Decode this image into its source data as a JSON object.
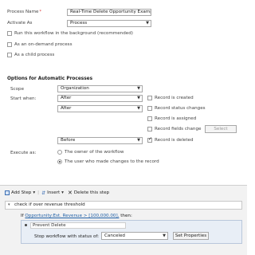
{
  "process": {
    "name_label": "Process Name",
    "required_marker": "*",
    "name_value": "Real-Time Delete Opportunity Example",
    "activate_as_label": "Activate As",
    "activate_as_value": "Process"
  },
  "options": {
    "run_background": "Run this workflow in the background (recommended)",
    "on_demand": "As an on-demand process",
    "child_process": "As a child process"
  },
  "automatic": {
    "title": "Options for Automatic Processes",
    "scope_label": "Scope",
    "scope_value": "Organization",
    "start_when_label": "Start when:",
    "after_1": "After",
    "after_2": "After",
    "before": "Before",
    "record_created": "Record is created",
    "record_status": "Record status changes",
    "record_assigned": "Record is assigned",
    "record_fields": "Record fields change",
    "select_button": "Select",
    "record_deleted": "Record is deleted",
    "execute_as_label": "Execute as:",
    "owner_option": "The owner of the workflow",
    "user_option": "The user who made changes to the record"
  },
  "toolbar": {
    "add_step": "Add Step",
    "insert": "Insert",
    "delete_step": "Delete this step",
    "dropdown_arrow": "▾"
  },
  "steps": {
    "check_title": "check if over revenue threshold",
    "if_prefix": "If",
    "condition": "Opportunity:Est. Revenue > [100,000.00],",
    "then": "then:",
    "prevent_delete": "Prevent Delete",
    "stop_label": "Stop workflow with status of:",
    "stop_status": "Canceled",
    "set_properties": "Set Properties"
  }
}
